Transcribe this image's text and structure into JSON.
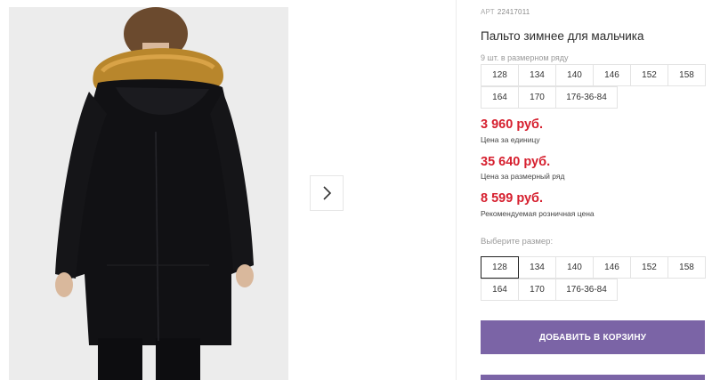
{
  "product": {
    "sku_label": "АРТ",
    "sku_value": "22417011",
    "title": "Пальто зимнее для мальчика",
    "size_row_note": "9 шт. в размерном ряду",
    "size_row": [
      "128",
      "134",
      "140",
      "146",
      "152",
      "158",
      "164",
      "170",
      "176-36-84"
    ]
  },
  "prices": {
    "unit_price": "3 960 руб.",
    "unit_label": "Цена за единицу",
    "row_price": "35 640 руб.",
    "row_label": "Цена за размерный ряд",
    "retail_price": "8 599 руб.",
    "retail_label": "Рекомендуемая розничная цена"
  },
  "size_selector": {
    "label": "Выберите размер:",
    "options": [
      "128",
      "134",
      "140",
      "146",
      "152",
      "158",
      "164",
      "170",
      "176-36-84"
    ],
    "selected": "128"
  },
  "actions": {
    "add_to_cart": "ДОБАВИТЬ В КОРЗИНУ"
  },
  "gallery": {
    "next_icon": "chevron-right-icon"
  },
  "colors": {
    "price": "#d6202f",
    "button": "#7b64a6"
  }
}
